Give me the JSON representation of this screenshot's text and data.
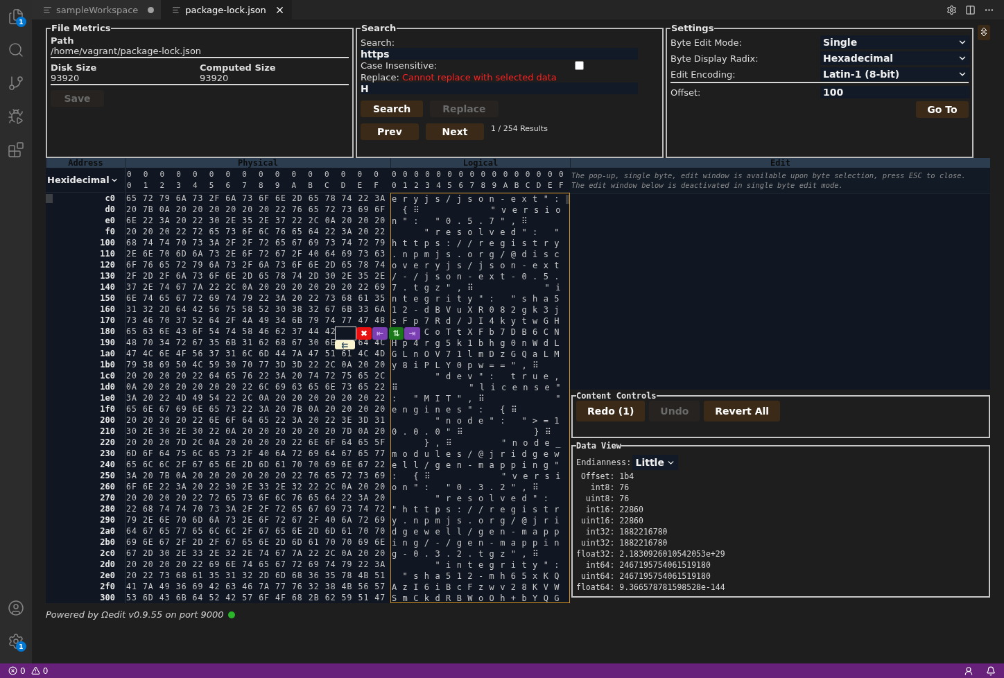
{
  "activity_bar": {
    "top": [
      {
        "kind": "files",
        "badge": "1"
      },
      {
        "kind": "search"
      },
      {
        "kind": "source-control"
      },
      {
        "kind": "run-debug"
      },
      {
        "kind": "extensions"
      }
    ],
    "bottom": [
      {
        "kind": "account"
      },
      {
        "kind": "manage",
        "badge": "1"
      }
    ]
  },
  "tabs": [
    {
      "label": "sampleWorkspace",
      "selected": false,
      "dirty": true
    },
    {
      "label": "package-lock.json",
      "selected": true,
      "dirty": false
    }
  ],
  "file_metrics": {
    "title": "File Metrics",
    "path_label": "Path",
    "path": "/home/vagrant/package-lock.json",
    "disk_size_label": "Disk Size",
    "disk_size": "93920",
    "computed_size_label": "Computed Size",
    "computed_size": "93920",
    "save_button": {
      "label": "Save",
      "disabled": true
    }
  },
  "search": {
    "title": "Search",
    "search_label": "Search:",
    "search_value": "https",
    "case_label": "Case Insensitive:",
    "case_insensitive": false,
    "replace_label": "Replace:",
    "replace_error": "Cannot replace with selected data",
    "replace_value": "H",
    "buttons": [
      {
        "label": "Search",
        "disabled": false
      },
      {
        "label": "Replace",
        "disabled": true
      }
    ],
    "nav_buttons": [
      {
        "label": "Prev",
        "disabled": false
      },
      {
        "label": "Next",
        "disabled": false
      }
    ],
    "results": "1 / 254 Results"
  },
  "settings": {
    "title": "Settings",
    "fields": [
      {
        "label": "Byte Edit Mode:",
        "value": "Single"
      },
      {
        "label": "Byte Display Radix:",
        "value": "Hexadecimal"
      },
      {
        "label": "Edit Encoding:",
        "value": "Latin-1 (8-bit)"
      }
    ],
    "offset_label": "Offset:",
    "offset_value": "100",
    "goto_button": "Go To"
  },
  "viewport": {
    "headers": [
      "Address",
      "Physical",
      "Logical",
      "Edit"
    ],
    "address_radix": "Hexidecimal",
    "physical_column_labels": [
      "00",
      "01",
      "02",
      "03",
      "04",
      "05",
      "06",
      "07",
      "08",
      "09",
      "0A",
      "0B",
      "0C",
      "0D",
      "0E",
      "0F"
    ],
    "logical_column_labels": [
      "00",
      "01",
      "02",
      "03",
      "04",
      "05",
      "06",
      "07",
      "08",
      "09",
      "0A",
      "0B",
      "0C",
      "0D",
      "0E",
      "0F"
    ],
    "rows": [
      {
        "address": "c0",
        "hex": "65 72 79 6A 73 2F 6A 73 6F 6E 2D 65 78 74 22 3A",
        "text": "eryjs/json-ext\":"
      },
      {
        "address": "d0",
        "hex": "20 7B 0A 20 20 20 20 20 20 22 76 65 72 73 69 6F",
        "text": " {⠿      \"versio"
      },
      {
        "address": "e0",
        "hex": "6E 22 3A 20 22 30 2E 35 2E 37 22 2C 0A 20 20 20",
        "text": "n\": \"0.5.7\",⠿   "
      },
      {
        "address": "f0",
        "hex": "20 20 20 22 72 65 73 6F 6C 76 65 64 22 3A 20 22",
        "text": "   \"resolved\": \""
      },
      {
        "address": "100",
        "hex": "68 74 74 70 73 3A 2F 2F 72 65 67 69 73 74 72 79",
        "text": "https://registry"
      },
      {
        "address": "110",
        "hex": "2E 6E 70 6D 6A 73 2E 6F 72 67 2F 40 64 69 73 63",
        "text": ".npmjs.org/@disc"
      },
      {
        "address": "120",
        "hex": "6F 76 65 72 79 6A 73 2F 6A 73 6F 6E 2D 65 78 74",
        "text": "overyjs/json-ext"
      },
      {
        "address": "130",
        "hex": "2F 2D 2F 6A 73 6F 6E 2D 65 78 74 2D 30 2E 35 2E",
        "text": "/-/json-ext-0.5."
      },
      {
        "address": "140",
        "hex": "37 2E 74 67 7A 22 2C 0A 20 20 20 20 20 20 22 69",
        "text": "7.tgz\",⠿      \"i"
      },
      {
        "address": "150",
        "hex": "6E 74 65 67 72 69 74 79 22 3A 20 22 73 68 61 35",
        "text": "ntegrity\": \"sha5"
      },
      {
        "address": "160",
        "hex": "31 32 2D 64 42 56 75 58 52 30 38 32 67 6B 33 6A",
        "text": "12-dBVuXR082gk3j"
      },
      {
        "address": "170",
        "hex": "73 46 70 37 52 64 2F 4A 49 34 6B 79 74 77 47 48",
        "text": "sFp7Rd/JI4kytwGH"
      },
      {
        "address": "180",
        "hex": "65 63 6E 43 6F 54 74 58 46 62 37 44 42",
        "text": "   CoTtXFb7DB6CN"
      },
      {
        "address": "190",
        "hex": "48 70 34 72 67 35 6B 31 62 68 67 30 6E    64 4C",
        "text": "Hp4rg5k1bhg0nWdL"
      },
      {
        "address": "1a0",
        "hex": "47 4C 6E 4F 56 37 31 6C 6D 44 7A 47 51 61 4C 4D",
        "text": "GLnOV71lmDzGQaLM"
      },
      {
        "address": "1b0",
        "hex": "79 38 69 50 4C 59 30 70 77 3D 3D 22 2C 0A 20 20",
        "text": "y8iPLY0pw==\",⠿  "
      },
      {
        "address": "1c0",
        "hex": "20 20 20 20 22 64 65 76 22 3A 20 74 72 75 65 2C",
        "text": "    \"dev\": true,"
      },
      {
        "address": "1d0",
        "hex": "0A 20 20 20 20 20 20 22 6C 69 63 65 6E 73 65 22",
        "text": "⠿      \"license\""
      },
      {
        "address": "1e0",
        "hex": "3A 20 22 4D 49 54 22 2C 0A 20 20 20 20 20 20 22",
        "text": ": \"MIT\",⠿      \""
      },
      {
        "address": "1f0",
        "hex": "65 6E 67 69 6E 65 73 22 3A 20 7B 0A 20 20 20 20",
        "text": "engines\": {⠿    "
      },
      {
        "address": "200",
        "hex": "20 20 20 20 22 6E 6F 64 65 22 3A 20 22 3E 3D 31",
        "text": "    \"node\": \">=1"
      },
      {
        "address": "210",
        "hex": "30 2E 30 2E 30 22 0A 20 20 20 20 20 20 7D 0A 20",
        "text": "0.0.0\"⠿      }⠿ "
      },
      {
        "address": "220",
        "hex": "20 20 20 7D 2C 0A 20 20 20 20 22 6E 6F 64 65 5F",
        "text": "   },⠿    \"node_"
      },
      {
        "address": "230",
        "hex": "6D 6F 64 75 6C 65 73 2F 40 6A 72 69 64 67 65 77",
        "text": "modules/@jridgew"
      },
      {
        "address": "240",
        "hex": "65 6C 6C 2F 67 65 6E 2D 6D 61 70 70 69 6E 67 22",
        "text": "ell/gen-mapping\""
      },
      {
        "address": "250",
        "hex": "3A 20 7B 0A 20 20 20 20 20 20 22 76 65 72 73 69",
        "text": ": {⠿      \"versi"
      },
      {
        "address": "260",
        "hex": "6F 6E 22 3A 20 22 30 2E 33 2E 32 22 2C 0A 20 20",
        "text": "on\": \"0.3.2\",⠿  "
      },
      {
        "address": "270",
        "hex": "20 20 20 20 22 72 65 73 6F 6C 76 65 64 22 3A 20",
        "text": "    \"resolved\": "
      },
      {
        "address": "280",
        "hex": "22 68 74 74 70 73 3A 2F 2F 72 65 67 69 73 74 72",
        "text": "\"https://registr"
      },
      {
        "address": "290",
        "hex": "79 2E 6E 70 6D 6A 73 2E 6F 72 67 2F 40 6A 72 69",
        "text": "y.npmjs.org/@jri"
      },
      {
        "address": "2a0",
        "hex": "64 67 65 77 65 6C 6C 2F 67 65 6E 2D 6D 61 70 70",
        "text": "dgewell/gen-mapp"
      },
      {
        "address": "2b0",
        "hex": "69 6E 67 2F 2D 2F 67 65 6E 2D 6D 61 70 70 69 6E",
        "text": "ing/-/gen-mappin"
      },
      {
        "address": "2c0",
        "hex": "67 2D 30 2E 33 2E 32 2E 74 67 7A 22 2C 0A 20 20",
        "text": "g-0.3.2.tgz\",⠿  "
      },
      {
        "address": "2d0",
        "hex": "20 20 20 20 22 69 6E 74 65 67 72 69 74 79 22 3A",
        "text": "    \"integrity\":"
      },
      {
        "address": "2e0",
        "hex": "20 22 73 68 61 35 31 32 2D 6D 68 36 35 78 4B 51",
        "text": " \"sha512-mh65xKQ"
      },
      {
        "address": "2f0",
        "hex": "41 7A 49 36 69 42 63 46 7A 77 76 32 38 4B 56 57",
        "text": "AzI6iBcFzwv28KVW"
      },
      {
        "address": "300",
        "hex": "53 6D 43 6B 64 52 42 57 6F 4F 68 2B 62 59 51 47",
        "text": "SmCkdRBWoOh+bYQG"
      }
    ],
    "byte_editor": {
      "buttons": [
        {
          "kind": "delete",
          "glyph": "✖"
        },
        {
          "kind": "previous",
          "glyph": "⇤"
        },
        {
          "kind": "swap",
          "glyph": "⇅"
        },
        {
          "kind": "next",
          "glyph": "⇥"
        },
        {
          "kind": "insert",
          "glyph": "⇇"
        }
      ]
    },
    "edit_hint": [
      "The pop-up, single byte, edit window is available upon byte selection, press ESC to close.",
      "The edit window below is deactivated in single byte edit mode."
    ]
  },
  "content_controls": {
    "title": "Content Controls",
    "buttons": [
      {
        "label": "Redo (1)",
        "disabled": false
      },
      {
        "label": "Undo",
        "disabled": true
      },
      {
        "label": "Revert All",
        "disabled": false
      }
    ]
  },
  "data_view": {
    "title": "Data View",
    "endianness_label": "Endianness:",
    "endianness": "Little",
    "values": [
      {
        "label": "Offset:",
        "value": "1b4"
      },
      {
        "label": "int8:",
        "value": "76"
      },
      {
        "label": "uint8:",
        "value": "76"
      },
      {
        "label": "int16:",
        "value": "22860"
      },
      {
        "label": "uint16:",
        "value": "22860"
      },
      {
        "label": "int32:",
        "value": "1882216780"
      },
      {
        "label": "uint32:",
        "value": "1882216780"
      },
      {
        "label": "float32:",
        "value": "2.1830926010542053e+29"
      },
      {
        "label": "int64:",
        "value": "2467195754061519180"
      },
      {
        "label": "uint64:",
        "value": "2467195754061519180"
      },
      {
        "label": "float64:",
        "value": "9.366578781598528e-144"
      }
    ]
  },
  "footer": {
    "text": "Powered by Ωedit v0.9.55 on port 9000",
    "connected": true
  },
  "status_bar": {
    "errors": "0",
    "warnings": "0"
  }
}
